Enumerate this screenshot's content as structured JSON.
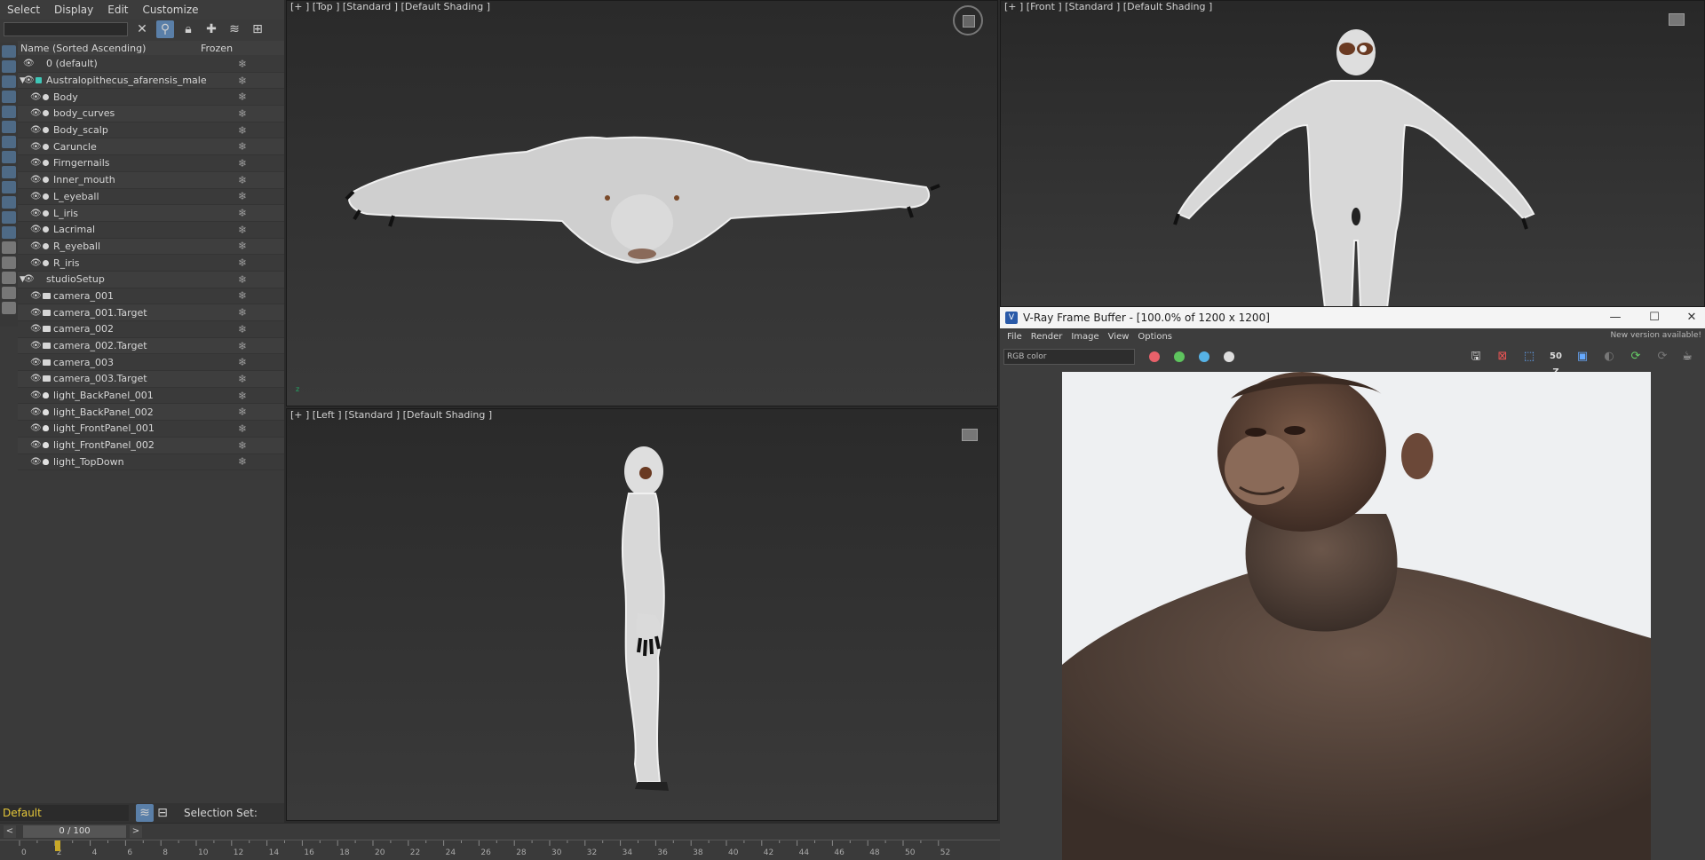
{
  "menubar": {
    "items": [
      "Select",
      "Display",
      "Edit",
      "Customize"
    ]
  },
  "explorer": {
    "header": {
      "name_col": "Name (Sorted Ascending)",
      "frozen_col": "Frozen"
    },
    "rows": [
      {
        "label": "0 (default)",
        "type": "layer-default",
        "indent": 0
      },
      {
        "label": "Australopithecus_afarensis_male",
        "type": "layer",
        "indent": 0
      },
      {
        "label": "Body",
        "type": "mesh",
        "indent": 1
      },
      {
        "label": "body_curves",
        "type": "group",
        "indent": 1
      },
      {
        "label": "Body_scalp",
        "type": "mesh",
        "indent": 1
      },
      {
        "label": "Caruncle",
        "type": "mesh",
        "indent": 1
      },
      {
        "label": "Firngernails",
        "type": "mesh",
        "indent": 1
      },
      {
        "label": "Inner_mouth",
        "type": "mesh",
        "indent": 1
      },
      {
        "label": "L_eyeball",
        "type": "mesh",
        "indent": 1
      },
      {
        "label": "L_iris",
        "type": "mesh",
        "indent": 1
      },
      {
        "label": "Lacrimal",
        "type": "mesh",
        "indent": 1
      },
      {
        "label": "R_eyeball",
        "type": "mesh",
        "indent": 1
      },
      {
        "label": "R_iris",
        "type": "mesh",
        "indent": 1
      },
      {
        "label": "studioSetup",
        "type": "layer2",
        "indent": 0
      },
      {
        "label": "camera_001",
        "type": "camera",
        "indent": 1
      },
      {
        "label": "camera_001.Target",
        "type": "camera",
        "indent": 1
      },
      {
        "label": "camera_002",
        "type": "camera",
        "indent": 1
      },
      {
        "label": "camera_002.Target",
        "type": "camera",
        "indent": 1
      },
      {
        "label": "camera_003",
        "type": "camera",
        "indent": 1
      },
      {
        "label": "camera_003.Target",
        "type": "camera",
        "indent": 1
      },
      {
        "label": "light_BackPanel_001",
        "type": "light",
        "indent": 1
      },
      {
        "label": "light_BackPanel_002",
        "type": "light",
        "indent": 1
      },
      {
        "label": "light_FrontPanel_001",
        "type": "light",
        "indent": 1
      },
      {
        "label": "light_FrontPanel_002",
        "type": "light",
        "indent": 1
      },
      {
        "label": "light_TopDown",
        "type": "light",
        "indent": 1
      }
    ]
  },
  "layer_bar": {
    "current_layer": "Default",
    "selection_set_label": "Selection Set:"
  },
  "timeslider": {
    "position": "0 / 100",
    "prev": "<",
    "next": ">"
  },
  "trackbar": {
    "ticks": [
      "0",
      "2",
      "4",
      "6",
      "8",
      "10",
      "12",
      "14",
      "16",
      "18",
      "20",
      "22",
      "24",
      "26",
      "28",
      "30",
      "32",
      "34",
      "36",
      "38",
      "40",
      "42",
      "44",
      "46",
      "48",
      "50",
      "52"
    ]
  },
  "viewports": {
    "top": {
      "label": "[+ ] [Top ]  [Standard ]  [Default Shading ]"
    },
    "left": {
      "label": "[+ ]  [Left ]   [Standard ]  [Default Shading ]"
    },
    "front": {
      "label": "[+ ]  [Front ]  [Standard ]  [Default Shading ]"
    }
  },
  "vfb": {
    "title": "V-Ray Frame Buffer - [100.0% of 1200 x 1200]",
    "menu": [
      "File",
      "Render",
      "Image",
      "View",
      "Options"
    ],
    "new_version": "New version available!",
    "channel": "RGB color",
    "zoom_badge": "50 Z",
    "dot_colors": [
      "#e8616a",
      "#5ec45e",
      "#56b2e6"
    ]
  },
  "colors": {
    "accent": "#5a7fa8",
    "layer_active": "#e7c93a",
    "render_bg": "#eef0f2"
  }
}
